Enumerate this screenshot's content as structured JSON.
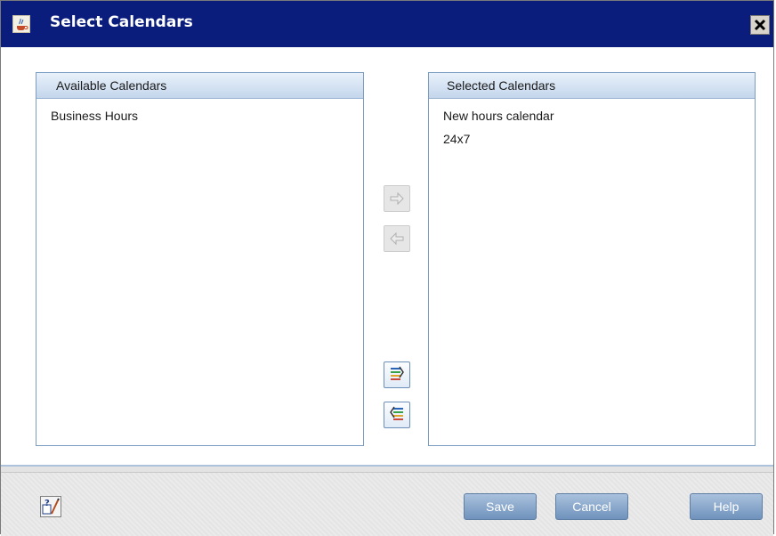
{
  "window": {
    "title": "Select Calendars"
  },
  "available": {
    "header": "Available Calendars",
    "items": [
      "Business Hours"
    ]
  },
  "selected": {
    "header": "Selected Calendars",
    "items": [
      "New hours calendar",
      "24x7"
    ]
  },
  "buttons": {
    "save": "Save",
    "cancel": "Cancel",
    "help": "Help"
  },
  "icons": {
    "app": "java-cup-icon",
    "close": "close-icon",
    "move_right": "arrow-right-icon",
    "move_left": "arrow-left-icon",
    "move_all_right": "move-all-right-icon",
    "move_all_left": "move-all-left-icon",
    "context_help": "context-help-icon"
  },
  "colors": {
    "titlebar": "#0b1d7c",
    "panel_border": "#7b9cc2",
    "button": "#7d9dc4"
  }
}
